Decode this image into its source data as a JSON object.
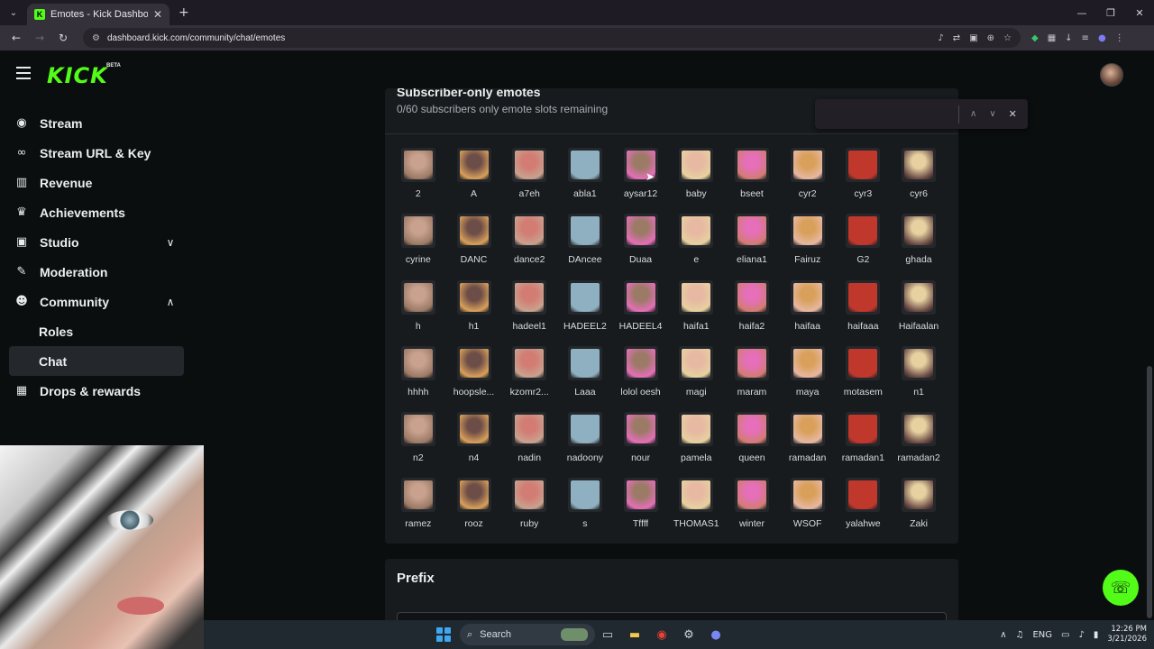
{
  "browser": {
    "tab_title": "Emotes - Kick Dashboard",
    "url": "dashboard.kick.com/community/chat/emotes",
    "tab_menu_icon": "chevron-down-icon",
    "new_tab_icon": "plus-icon"
  },
  "header": {
    "logo_text": "KICK",
    "badge": "BETA"
  },
  "sidebar": {
    "items": [
      {
        "label": "Stream",
        "icon": "broadcast-icon"
      },
      {
        "label": "Stream URL & Key",
        "icon": "link-icon"
      },
      {
        "label": "Revenue",
        "icon": "chart-icon"
      },
      {
        "label": "Achievements",
        "icon": "trophy-icon"
      },
      {
        "label": "Studio",
        "icon": "studio-icon"
      },
      {
        "label": "Moderation",
        "icon": "wrench-icon"
      },
      {
        "label": "Community",
        "icon": "users-icon"
      },
      {
        "label": "Roles"
      },
      {
        "label": "Chat"
      },
      {
        "label": "Drops & rewards",
        "icon": "gift-icon"
      }
    ]
  },
  "emotes_panel": {
    "title": "Subscriber-only emotes",
    "subtitle": "0/60 subscribers only emote slots remaining",
    "emotes": [
      "2",
      "A",
      "a7eh",
      "abla1",
      "aysar12",
      "baby",
      "bseet",
      "cyr2",
      "cyr3",
      "cyr6",
      "cyrine",
      "DANC",
      "dance2",
      "DAncee",
      "Duaa",
      "e",
      "eliana1",
      "Fairuz",
      "G2",
      "ghada",
      "h",
      "h1",
      "hadeel1",
      "HADEEL2",
      "HADEEL4",
      "haifa1",
      "haifa2",
      "haifaa",
      "haifaaa",
      "Haifaalan",
      "hhhh",
      "hoopsle...",
      "kzomr2...",
      "Laaa",
      "lolol oesh",
      "magi",
      "maram",
      "maya",
      "motasem",
      "n1",
      "n2",
      "n4",
      "nadin",
      "nadoony",
      "nour",
      "pamela",
      "queen",
      "ramadan",
      "ramadan1",
      "ramadan2",
      "ramez",
      "rooz",
      "ruby",
      "s",
      "Tffff",
      "THOMAS1",
      "winter",
      "WSOF",
      "yalahwe",
      "Zaki"
    ]
  },
  "prefix_panel": {
    "title": "Prefix"
  },
  "taskbar": {
    "search_label": "Search",
    "language": "ENG",
    "time": "12:26 PM",
    "date": "3/21/2026"
  },
  "colors": {
    "brand": "#53fc18",
    "background": "#0b0e0f",
    "panel": "#181b1e"
  }
}
